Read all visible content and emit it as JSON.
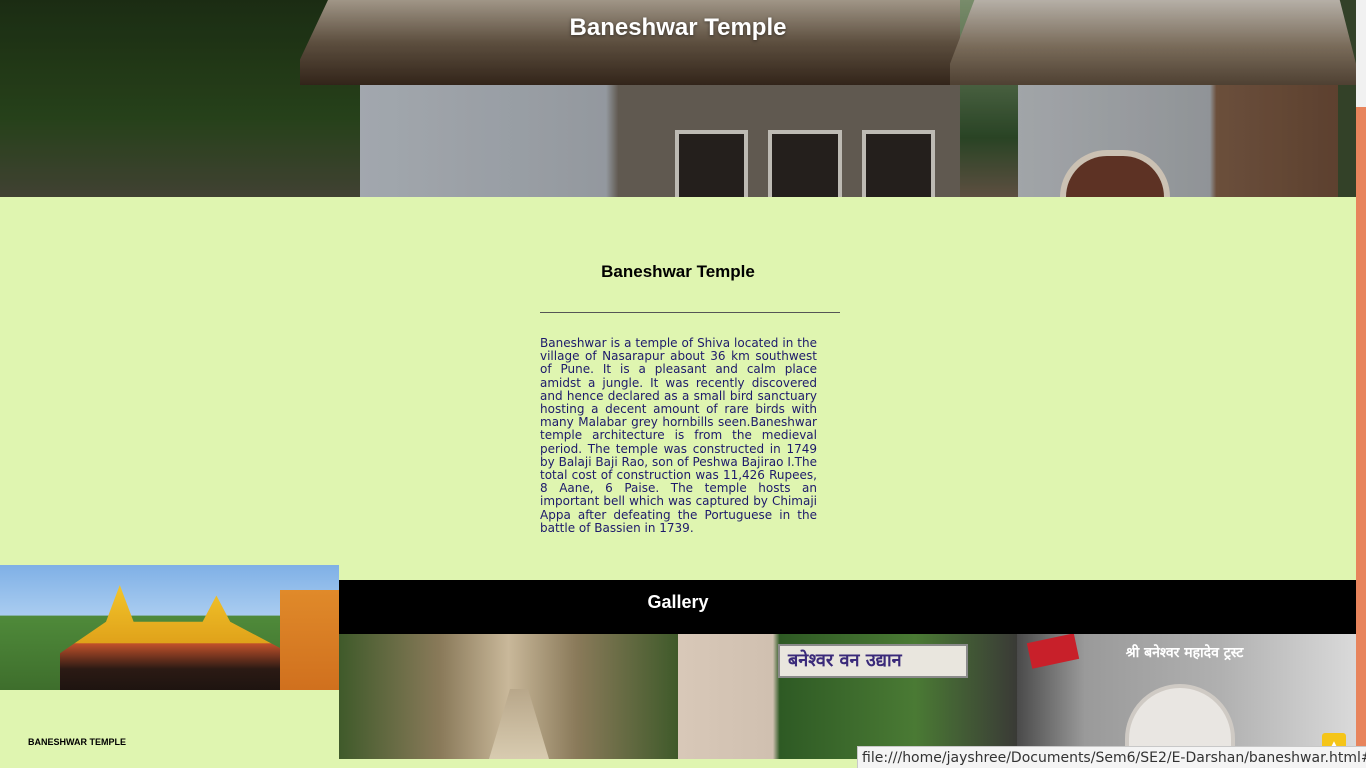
{
  "header": {
    "title": "Baneshwar Temple"
  },
  "about": {
    "heading": "Baneshwar Temple",
    "body": "Baneshwar is a temple of Shiva located in the village of Nasarapur about 36 km southwest of Pune. It is a pleasant and calm place amidst a jungle. It was recently discovered and hence declared as a small bird sanctuary hosting a decent amount of rare birds with many Malabar grey hornbills seen.Baneshwar temple architecture is from the medieval period. The temple was constructed in 1749 by Balaji Baji Rao, son of Peshwa Bajirao I.The total cost of construction was 11,426 Rupees, 8 Aane, 6 Paise. The temple hosts an important bell which was captured by Chimaji Appa after defeating the Portuguese in the battle of Bassien in 1739."
  },
  "gallery": {
    "title": "Gallery",
    "caption": "BANESHWAR TEMPLE",
    "images": [
      {
        "sign_text": ""
      },
      {
        "sign_text": ""
      },
      {
        "sign_text": "बनेश्वर वन उद्यान"
      },
      {
        "sign_text": "श्री बनेश्वर महादेव ट्रस्ट"
      }
    ]
  },
  "statusbar": {
    "url": "file:///home/jayshree/Documents/Sem6/SE2/E-Darshan/baneshwar.html#"
  },
  "colors": {
    "background": "#dff5b0",
    "about_text": "#1d1a6b",
    "gallery_bar": "#000000",
    "scroll_thumb": "#e8845c",
    "back_to_top": "#f5c518"
  },
  "icons": {
    "back_to_top": "arrow-up-icon"
  }
}
